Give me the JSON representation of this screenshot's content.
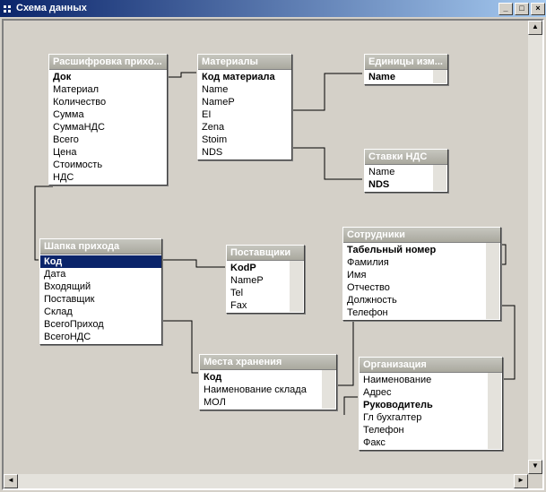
{
  "window": {
    "title": "Схема данных"
  },
  "tables": {
    "rasshifrovka": {
      "title": "Расшифровка прихо...",
      "fields": [
        {
          "name": "Док",
          "pk": true
        },
        {
          "name": "Материал"
        },
        {
          "name": "Количество"
        },
        {
          "name": "Сумма"
        },
        {
          "name": "СуммаНДС"
        },
        {
          "name": "Всего"
        },
        {
          "name": "Цена"
        },
        {
          "name": "Стоимость"
        },
        {
          "name": "НДС"
        }
      ]
    },
    "materialy": {
      "title": "Материалы",
      "fields": [
        {
          "name": "Код материала",
          "pk": true
        },
        {
          "name": "Name"
        },
        {
          "name": "NameP"
        },
        {
          "name": "EI"
        },
        {
          "name": "Zena"
        },
        {
          "name": "Stoim"
        },
        {
          "name": "NDS"
        }
      ]
    },
    "edinicy": {
      "title": "Единицы изм...",
      "fields": [
        {
          "name": "Name",
          "pk": true
        }
      ]
    },
    "stavki": {
      "title": "Ставки НДС",
      "fields": [
        {
          "name": "Name"
        },
        {
          "name": "NDS",
          "pk": true
        }
      ]
    },
    "shapka": {
      "title": "Шапка прихода",
      "fields": [
        {
          "name": "Код",
          "pk": true,
          "selected": true
        },
        {
          "name": "Дата"
        },
        {
          "name": "Входящий"
        },
        {
          "name": "Поставщик"
        },
        {
          "name": "Склад"
        },
        {
          "name": "ВсегоПриход"
        },
        {
          "name": "ВсегоНДС"
        }
      ]
    },
    "postavshiki": {
      "title": "Поставщики",
      "fields": [
        {
          "name": "KodP",
          "pk": true
        },
        {
          "name": "NameP"
        },
        {
          "name": "Tel"
        },
        {
          "name": "Fax"
        }
      ]
    },
    "mesta": {
      "title": "Места хранения",
      "fields": [
        {
          "name": "Код",
          "pk": true
        },
        {
          "name": "Наименование склада"
        },
        {
          "name": "МОЛ"
        }
      ]
    },
    "sotrudniki": {
      "title": "Сотрудники",
      "fields": [
        {
          "name": "Табельный номер",
          "pk": true
        },
        {
          "name": "Фамилия"
        },
        {
          "name": "Имя"
        },
        {
          "name": "Отчество"
        },
        {
          "name": "Должность"
        },
        {
          "name": "Телефон"
        }
      ]
    },
    "organizacia": {
      "title": "Организация",
      "fields": [
        {
          "name": "Наименование"
        },
        {
          "name": "Адрес"
        },
        {
          "name": "Руководитель",
          "pk": true
        },
        {
          "name": "Гл бухгалтер"
        },
        {
          "name": "Телефон"
        },
        {
          "name": "Факс"
        }
      ]
    }
  }
}
